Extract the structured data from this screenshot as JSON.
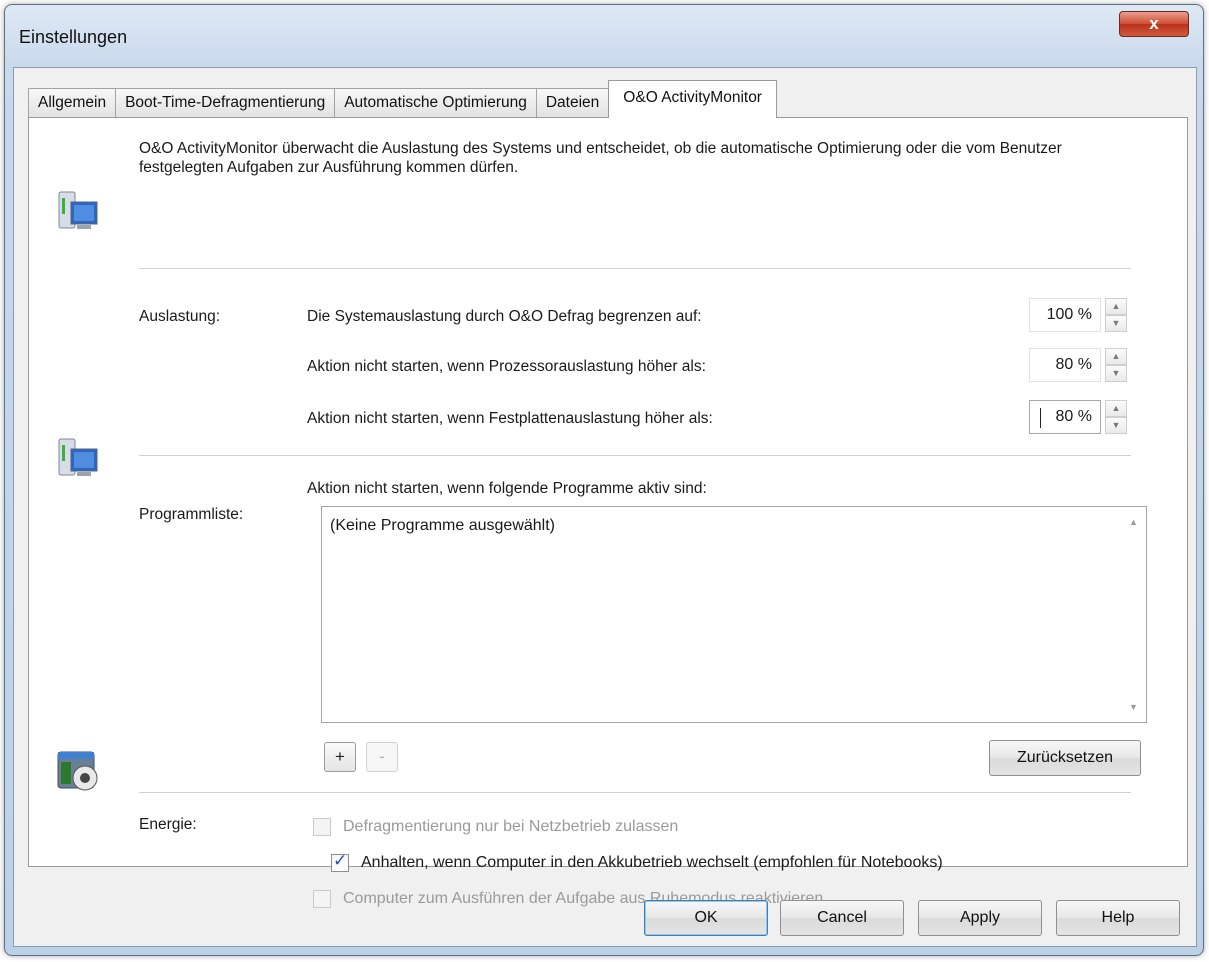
{
  "window": {
    "title": "Einstellungen",
    "close_glyph": "x"
  },
  "tabs": [
    {
      "label": "Allgemein",
      "active": false
    },
    {
      "label": "Boot-Time-Defragmentierung",
      "active": false
    },
    {
      "label": "Automatische Optimierung",
      "active": false
    },
    {
      "label": "Dateien",
      "active": false
    },
    {
      "label": "O&O ActivityMonitor",
      "active": true
    }
  ],
  "description": "O&O ActivityMonitor überwacht die Auslastung des Systems und entscheidet, ob die automatische Optimierung oder die vom Benutzer festgelegten Aufgaben zur Ausführung kommen dürfen.",
  "auslastung": {
    "section_label": "Auslastung:",
    "rows": [
      {
        "label": "Die Systemauslastung durch O&O Defrag begrenzen auf:",
        "value": "100 %"
      },
      {
        "label": "Aktion nicht starten, wenn Prozessorauslastung höher als:",
        "value": "80 %"
      },
      {
        "label": "Aktion nicht starten, wenn Festplattenauslastung höher als:",
        "value": "80 %"
      }
    ]
  },
  "programmliste": {
    "section_label": "Programmliste:",
    "caption": "Aktion nicht starten, wenn folgende Programme aktiv sind:",
    "empty_text": "(Keine Programme ausgewählt)",
    "add_label": "+",
    "remove_label": "-",
    "reset_label": "Zurücksetzen"
  },
  "energie": {
    "section_label": "Energie:",
    "options": [
      {
        "label": "Defragmentierung nur bei Netzbetrieb zulassen",
        "checked": false,
        "enabled": false
      },
      {
        "label": "Anhalten, wenn Computer in den Akkubetrieb wechselt (empfohlen für Notebooks)",
        "checked": true,
        "enabled": true
      },
      {
        "label": "Computer zum Ausführen der Aufgabe aus Ruhemodus reaktivieren",
        "checked": false,
        "enabled": false
      }
    ]
  },
  "footer": {
    "ok": "OK",
    "cancel": "Cancel",
    "apply": "Apply",
    "help": "Help"
  },
  "icons": {
    "section_1": "monitor-computer-icon",
    "section_2": "monitor-computer-icon",
    "section_3": "power-settings-icon",
    "close": "close-icon",
    "spin_up": "chevron-up-icon",
    "spin_down": "chevron-down-icon"
  },
  "colors": {
    "window_frame": "#c9d9ec",
    "close_button": "#cf4b32",
    "checkbox_tick": "#2a4fa3"
  }
}
